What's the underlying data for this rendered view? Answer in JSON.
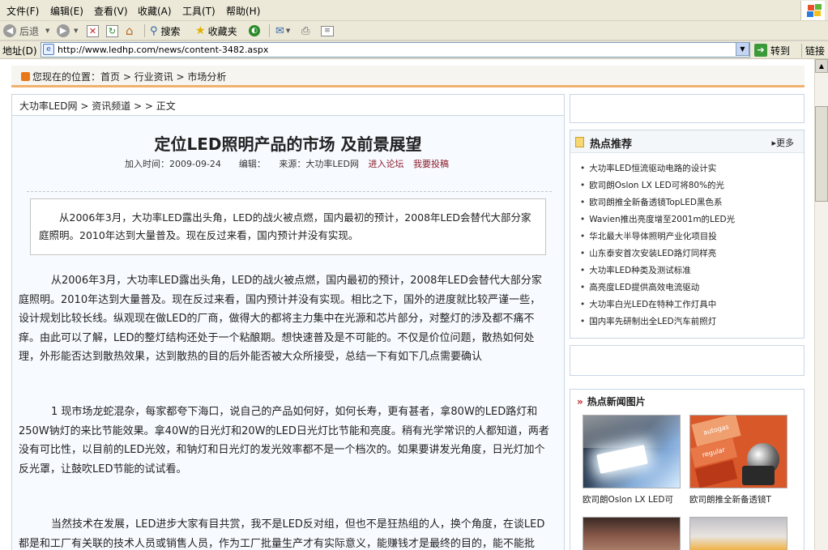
{
  "menu": [
    "文件(F)",
    "编辑(E)",
    "查看(V)",
    "收藏(A)",
    "工具(T)",
    "帮助(H)"
  ],
  "toolbar": {
    "back": "后退",
    "search": "搜索",
    "favorites": "收藏夹"
  },
  "address": {
    "label": "地址(D)",
    "url": "http://www.ledhp.com/news/content-3482.aspx",
    "go": "转到",
    "links": "链接"
  },
  "location": {
    "text": "您现在的位置：首页 > 行业资讯 > 市场分析"
  },
  "article": {
    "breadcrumb": "大功率LED网 > 资讯频道 > > 正文",
    "title": "定位LED照明产品的市场  及前景展望",
    "meta": "加入时间：2009-09-24　　编辑：　　来源：大功率LED网",
    "forum_link": "进入论坛",
    "submit_link": "我要投稿",
    "summary": "从2006年3月，大功率LED露出头角，LED的战火被点燃，国内最初的预计，2008年LED会替代大部分家庭照明。2010年达到大量普及。现在反过来看，国内预计并没有实现。",
    "paragraphs": [
      "从2006年3月，大功率LED露出头角，LED的战火被点燃，国内最初的预计，2008年LED会替代大部分家庭照明。2010年达到大量普及。现在反过来看，国内预计并没有实现。相比之下，国外的进度就比较严谨一些，设计规划比较长线。纵观现在做LED的厂商，做得大的都将主力集中在光源和芯片部分，对整灯的涉及都不痛不痒。由此可以了解，LED的整灯结构还处于一个粘酿期。想快速普及是不可能的。不仅是价位问题，散热如何处理，外形能否达到散热效果，达到散热的目的后外能否被大众所接受，总结一下有如下几点需要确认",
      "1  现市场龙蛇混杂，每家都夸下海口，说自己的产品如何好，如何长寿，更有甚者，拿80W的LED路灯和250W钠灯的来比节能效果。拿40W的日光灯和20W的LED日光灯比节能和亮度。稍有光学常识的人都知道，两者没有可比性，以目前的LED光效，和钠灯和日光灯的发光效率都不是一个档次的。如果要讲发光角度，日光灯加个反光罩，让鼓吹LED节能的试试看。",
      "当然技术在发展，LED进步大家有目共赏，我不是LED反对组，但也不是狂热组的人，换个角度，在谈LED都是和工厂有关联的技术人员或销售人员，作为工厂批量生产才有实际意义，能赚钱才是最终的目的，能不能批量，会不会赚钱，不是由那个人决定的，是由消费者决定，作为工程技术人员，严谨"
    ]
  },
  "hot": {
    "title": "热点推荐",
    "more": "更多",
    "items": [
      "大功率LED恒流驱动电路的设计实",
      "欧司朗Oslon LX LED可将80%的光",
      "欧司朗推全新备透镜TopLED黑色系",
      "Wavien推出亮度增至2001m的LED光",
      "华北最大半导体照明产业化项目投",
      "山东泰安首次安装LED路灯同样亮",
      "大功率LED种类及测试标准",
      "高亮度LED提供高效电流驱动",
      "大功率白光LED在特种工作灯具中",
      "国内率先研制出全LED汽车前照灯"
    ]
  },
  "pics": {
    "title": "热点新闻图片",
    "captions": [
      "欧司朗Oslon LX LED可",
      "欧司朗推全新备透镜T"
    ],
    "badge_text": [
      "autogas",
      "regular"
    ]
  }
}
